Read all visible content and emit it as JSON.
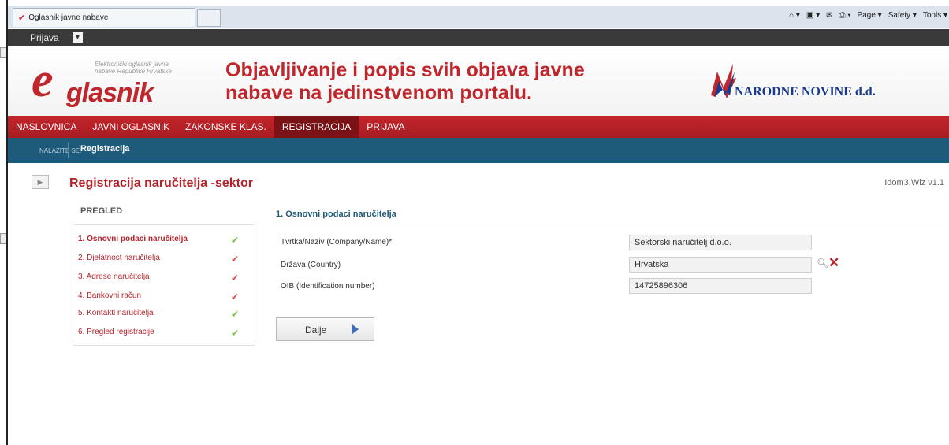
{
  "browser": {
    "tab_title": "Oglasnik javne nabave",
    "favicon": "oglasnik-favicon-icon",
    "commands": [
      "Page ▾",
      "Safety ▾",
      "Tools ▾"
    ]
  },
  "topbar": {
    "login_label": "Prijava"
  },
  "banner": {
    "logo_text": "glasnik",
    "logo_letter": "e",
    "logo_tagline": "Elektronički oglasnik javne nabave Republike Hrvatske",
    "headline_line1": "Objavljivanje i popis svih objava javne",
    "headline_line2": "nabave na jedinstvenom portalu.",
    "partner_logo": "NARODNE NOVINE d.d."
  },
  "nav": {
    "items": [
      "NASLOVNICA",
      "JAVNI OGLASNIK",
      "ZAKONSKE KLAS.",
      "REGISTRACIJA",
      "PRIJAVA"
    ],
    "active": "REGISTRACIJA"
  },
  "breadcrumb": {
    "label": "NALAZITE SE:",
    "current": "Registracija"
  },
  "page": {
    "title": "Registracija naručitelja -sektor",
    "version": "Idom3.Wiz v1.1"
  },
  "pregled": {
    "title": "PREGLED",
    "steps": [
      {
        "label": "1. Osnovni podaci naručitelja",
        "active": true
      },
      {
        "label": "2. Djelatnost naručitelja",
        "active": false
      },
      {
        "label": "3. Adrese naručitelja",
        "active": false
      },
      {
        "label": "4. Bankovni račun",
        "active": false
      },
      {
        "label": "5. Kontakti naručitelja",
        "active": false
      },
      {
        "label": "6. Pregled registracije",
        "active": false
      }
    ]
  },
  "form": {
    "section_title": "1. Osnovni podaci naručitelja",
    "fields": [
      {
        "label": "Tvrtka/Naziv (Company/Name)*",
        "value": "Sektorski naručitelj d.o.o."
      },
      {
        "label": "Država (Country)",
        "value": "Hrvatska"
      },
      {
        "label": "OIB (Identification number)",
        "value": "14725896306"
      }
    ],
    "next_label": "Dalje"
  },
  "colors": {
    "brand_red": "#c0262c",
    "nav_blue": "#1e5a7a",
    "check_green": "#7ab648",
    "check_red": "#d9534f"
  }
}
